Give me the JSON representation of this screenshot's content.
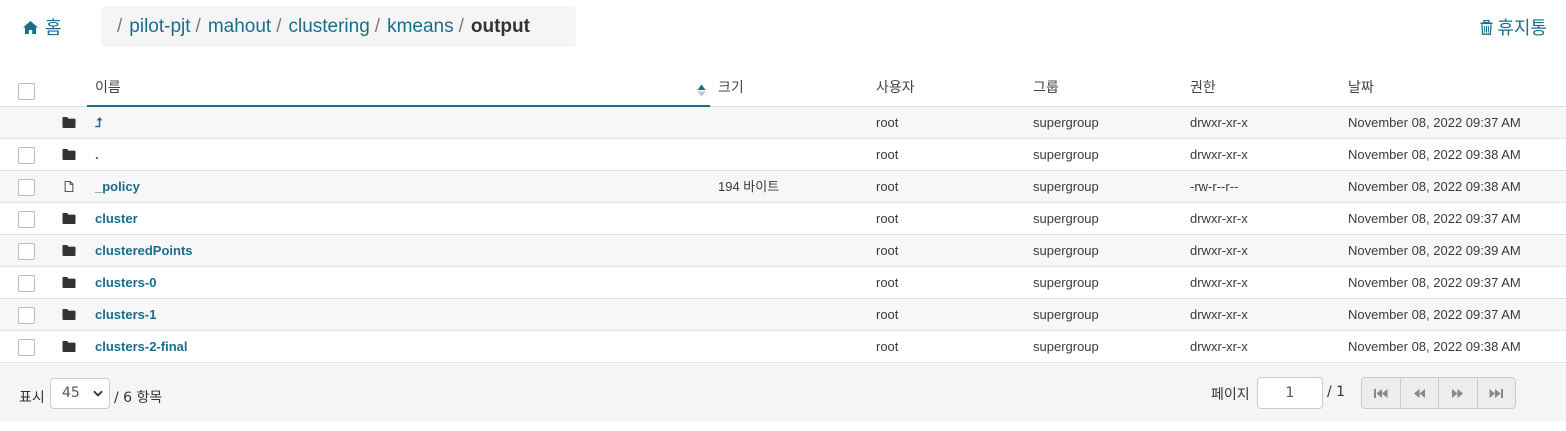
{
  "header": {
    "home_label": "홈",
    "breadcrumb": {
      "separator": "/",
      "links": [
        "pilot-pjt",
        "mahout",
        "clustering",
        "kmeans"
      ],
      "current": "output"
    },
    "trash_label": "휴지통"
  },
  "table": {
    "columns": {
      "name": "이름",
      "size": "크기",
      "user": "사용자",
      "group": "그룹",
      "permission": "권한",
      "date": "날짜"
    },
    "sort": {
      "column": "name",
      "direction": "ascending"
    },
    "rows": [
      {
        "type": "folder",
        "name": "⮥",
        "size": "",
        "user": "root",
        "group": "supergroup",
        "permission": "drwxr-xr-x",
        "date": "November 08, 2022 09:37 AM"
      },
      {
        "type": "folder",
        "name": ".",
        "size": "",
        "user": "root",
        "group": "supergroup",
        "permission": "drwxr-xr-x",
        "date": "November 08, 2022 09:38 AM"
      },
      {
        "type": "file",
        "name": "_policy",
        "size": "194 바이트",
        "user": "root",
        "group": "supergroup",
        "permission": "-rw-r--r--",
        "date": "November 08, 2022 09:38 AM"
      },
      {
        "type": "folder",
        "name": "cluster",
        "size": "",
        "user": "root",
        "group": "supergroup",
        "permission": "drwxr-xr-x",
        "date": "November 08, 2022 09:37 AM"
      },
      {
        "type": "folder",
        "name": "clusteredPoints",
        "size": "",
        "user": "root",
        "group": "supergroup",
        "permission": "drwxr-xr-x",
        "date": "November 08, 2022 09:39 AM"
      },
      {
        "type": "folder",
        "name": "clusters-0",
        "size": "",
        "user": "root",
        "group": "supergroup",
        "permission": "drwxr-xr-x",
        "date": "November 08, 2022 09:37 AM"
      },
      {
        "type": "folder",
        "name": "clusters-1",
        "size": "",
        "user": "root",
        "group": "supergroup",
        "permission": "drwxr-xr-x",
        "date": "November 08, 2022 09:37 AM"
      },
      {
        "type": "folder",
        "name": "clusters-2-final",
        "size": "",
        "user": "root",
        "group": "supergroup",
        "permission": "drwxr-xr-x",
        "date": "November 08, 2022 09:38 AM"
      }
    ]
  },
  "footer": {
    "show_label": "표시",
    "page_size": "45",
    "items_label": "/ 6 항목",
    "page_label": "페이지",
    "page_value": "1",
    "page_total": "/ 1"
  },
  "colors": {
    "accent": "#1b6d8f",
    "text": "#333333",
    "row_alt": "#f7f7f7",
    "footer_bg": "#f5f5f5"
  },
  "icons": {
    "home": "home-icon",
    "trash": "trash-icon",
    "folder": "folder-icon",
    "file": "file-icon",
    "sort": "sort-asc-icon",
    "first": "first-page-icon",
    "prev": "previous-page-icon",
    "next": "next-page-icon",
    "last": "last-page-icon"
  }
}
